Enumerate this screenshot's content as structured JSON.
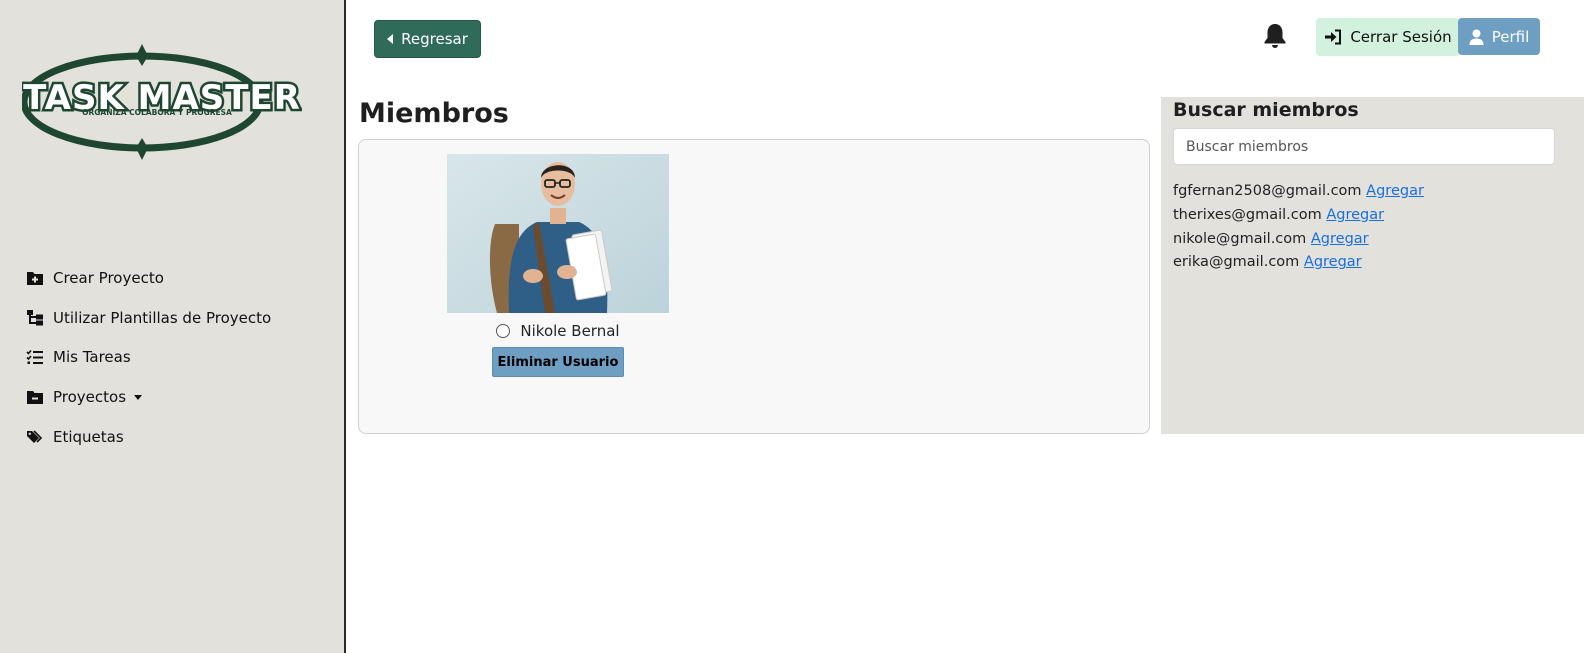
{
  "brand": {
    "title": "TASK MASTER",
    "tagline": "ORGANIZA COLABORA Y PROGRESA",
    "color": "#1f4630"
  },
  "sidebar": {
    "items": [
      {
        "label": "Crear Proyecto",
        "icon": "folder-plus-icon"
      },
      {
        "label": "Utilizar Plantillas de Proyecto",
        "icon": "sitemap-icon"
      },
      {
        "label": "Mis Tareas",
        "icon": "list-check-icon"
      },
      {
        "label": "Proyectos",
        "icon": "folder-minus-icon",
        "has_dropdown": true
      },
      {
        "label": "Etiquetas",
        "icon": "tags-icon"
      }
    ]
  },
  "header": {
    "back_label": "Regresar",
    "notifications_icon": "bell-icon",
    "logout_label": "Cerrar Sesión",
    "profile_label": "Perfil"
  },
  "members": {
    "title": "Miembros",
    "list": [
      {
        "name": "Nikole Bernal",
        "remove_label": "Eliminar Usuario"
      }
    ]
  },
  "search": {
    "title": "Buscar miembros",
    "placeholder": "Buscar miembros",
    "value": "",
    "results": [
      {
        "email": "fgfernan2508@gmail.com",
        "action": "Agregar"
      },
      {
        "email": "therixes@gmail.com",
        "action": "Agregar"
      },
      {
        "email": "nikole@gmail.com",
        "action": "Agregar"
      },
      {
        "email": "erika@gmail.com",
        "action": "Agregar"
      }
    ]
  },
  "colors": {
    "sidebar_bg": "#e2e1dc",
    "primary_green": "#2f6b58",
    "logout_bg": "#d3f1df",
    "profile_bg": "#6e9ec2",
    "link": "#1a6ee0"
  }
}
